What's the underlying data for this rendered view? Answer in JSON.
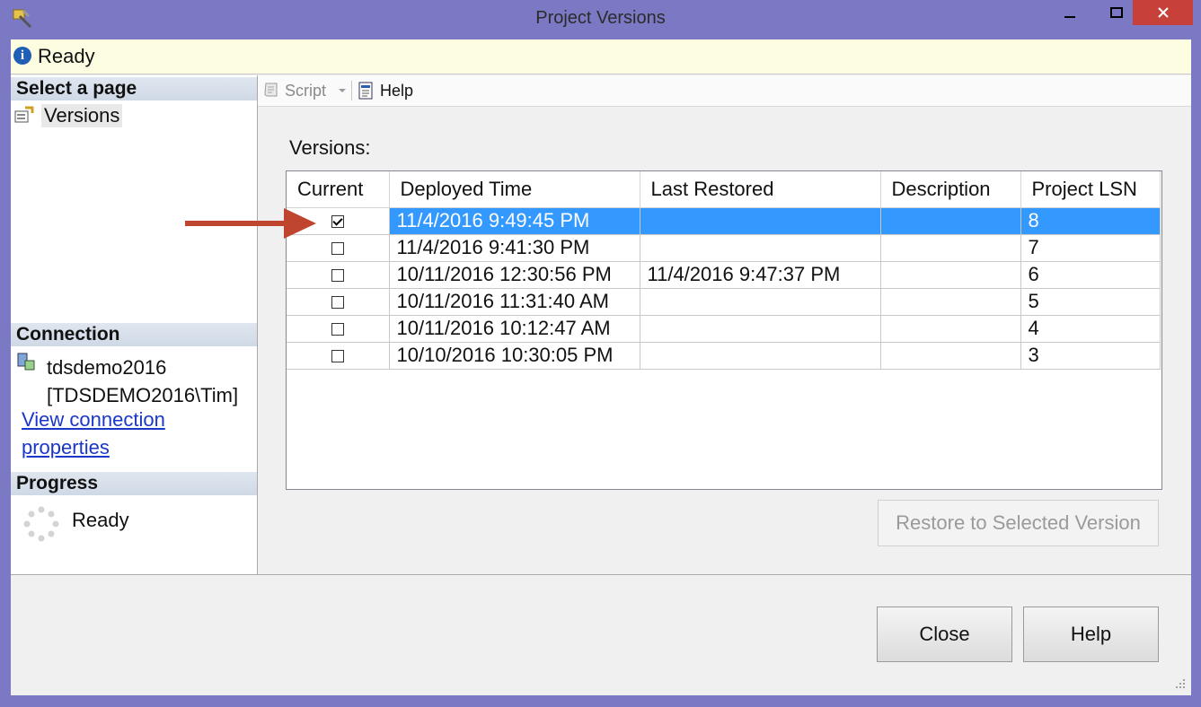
{
  "window": {
    "title": "Project Versions"
  },
  "infobar": {
    "status": "Ready"
  },
  "left": {
    "select_page_header": "Select a page",
    "pages": [
      {
        "label": "Versions"
      }
    ],
    "connection_header": "Connection",
    "server": "tdsdemo2016",
    "user": "[TDSDEMO2016\\Tim]",
    "view_connection_link": "View connection properties",
    "progress_header": "Progress",
    "progress_status": "Ready"
  },
  "toolbar": {
    "script_label": "Script",
    "help_label": "Help"
  },
  "main": {
    "versions_caption": "Versions:",
    "columns": [
      "Current",
      "Deployed Time",
      "Last Restored",
      "Description",
      "Project LSN"
    ],
    "rows": [
      {
        "current": true,
        "deployed": "11/4/2016 9:49:45 PM",
        "restored": "",
        "description": "",
        "lsn": "8"
      },
      {
        "current": false,
        "deployed": "11/4/2016 9:41:30 PM",
        "restored": "",
        "description": "",
        "lsn": "7"
      },
      {
        "current": false,
        "deployed": "10/11/2016 12:30:56 PM",
        "restored": "11/4/2016 9:47:37 PM",
        "description": "",
        "lsn": "6"
      },
      {
        "current": false,
        "deployed": "10/11/2016 11:31:40 AM",
        "restored": "",
        "description": "",
        "lsn": "5"
      },
      {
        "current": false,
        "deployed": "10/11/2016 10:12:47 AM",
        "restored": "",
        "description": "",
        "lsn": "4"
      },
      {
        "current": false,
        "deployed": "10/10/2016 10:30:05 PM",
        "restored": "",
        "description": "",
        "lsn": "3"
      }
    ],
    "selected_row": 0,
    "restore_button": "Restore to Selected Version"
  },
  "footer": {
    "close_label": "Close",
    "help_label": "Help"
  },
  "colors": {
    "selection": "#3399ff",
    "link": "#1a37c8",
    "titlebar": "#7b79c4",
    "close_button": "#c7413a",
    "annotation_arrow": "#c0452e"
  }
}
